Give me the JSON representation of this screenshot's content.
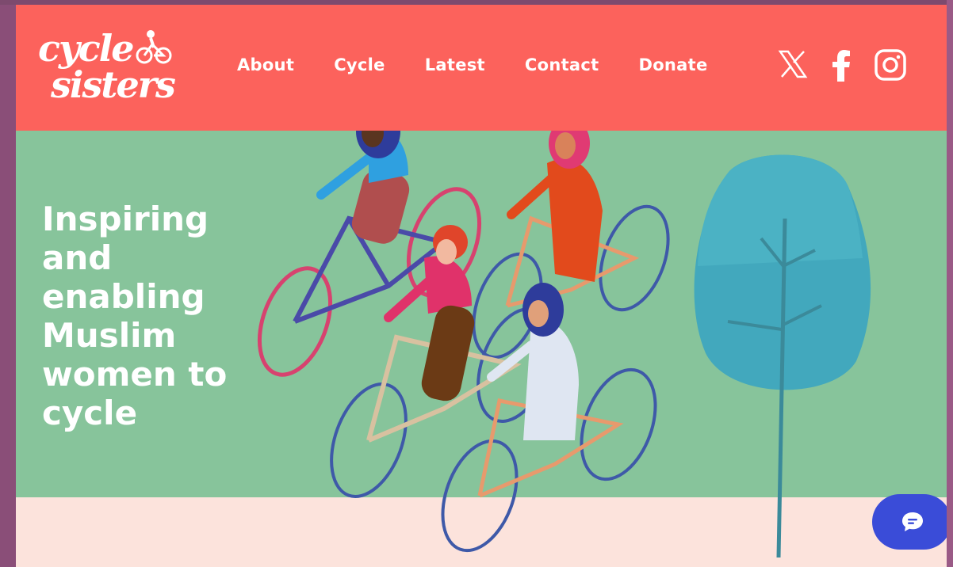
{
  "brand": {
    "logo_line1": "cycle",
    "logo_line2": "sisters",
    "colors": {
      "header": "#fc625c",
      "hero": "#87c49b",
      "ground": "#fce3dc",
      "chat": "#3a4cd8",
      "tree": "#3fa3b8"
    }
  },
  "nav": {
    "items": [
      {
        "label": "About"
      },
      {
        "label": "Cycle"
      },
      {
        "label": "Latest"
      },
      {
        "label": "Contact"
      },
      {
        "label": "Donate"
      }
    ]
  },
  "social": {
    "icons": [
      "x-icon",
      "facebook-icon",
      "instagram-icon"
    ]
  },
  "hero": {
    "title": "Inspiring\nand\nenabling\nMuslim\nwomen to\ncycle"
  },
  "chat": {
    "icon": "chat-bubble-icon"
  }
}
